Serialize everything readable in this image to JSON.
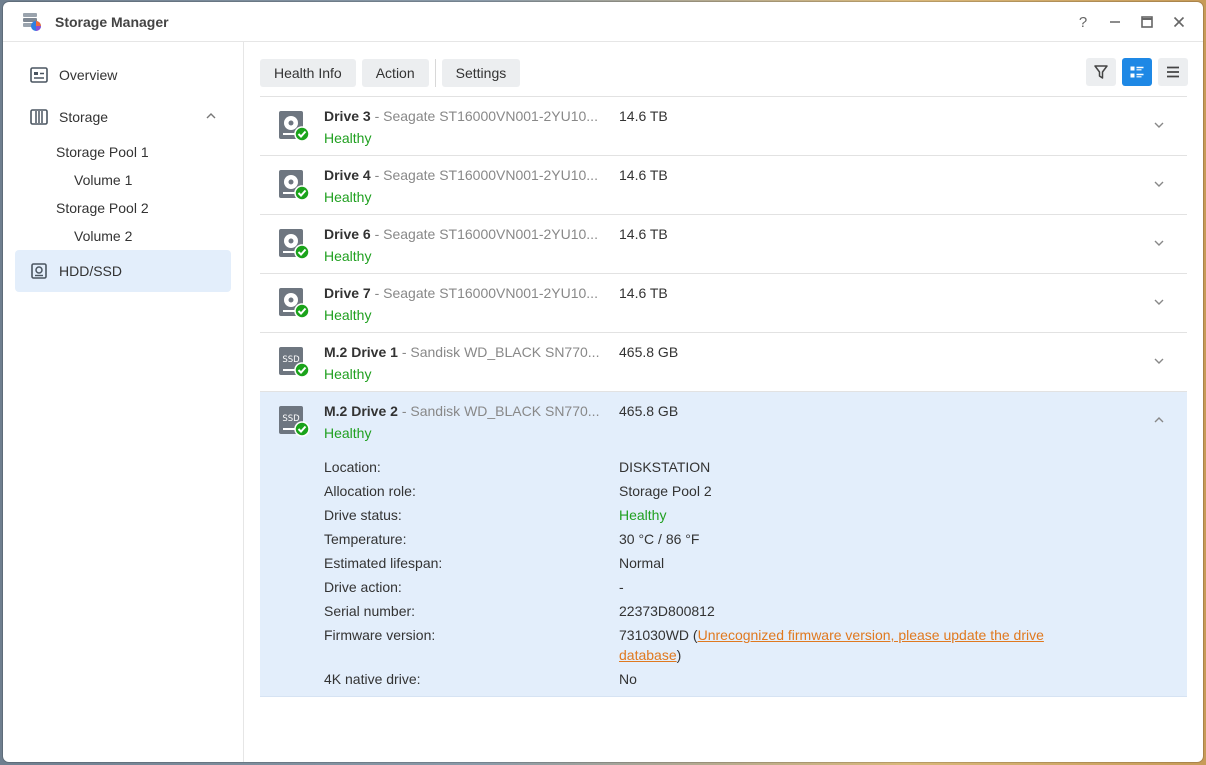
{
  "window": {
    "title": "Storage Manager",
    "controls": [
      "?",
      "–",
      "□",
      "×"
    ]
  },
  "sidebar": {
    "items": [
      {
        "label": "Overview",
        "icon": "overview-icon"
      },
      {
        "label": "Storage",
        "icon": "storage-icon",
        "expanded": true
      },
      {
        "label": "HDD/SSD",
        "icon": "hdd-icon",
        "active": true
      }
    ],
    "storage_children": [
      {
        "label": "Storage Pool 1",
        "level": 1
      },
      {
        "label": "Volume 1",
        "level": 2
      },
      {
        "label": "Storage Pool 2",
        "level": 1
      },
      {
        "label": "Volume 2",
        "level": 2
      }
    ]
  },
  "toolbar": {
    "health_info": "Health Info",
    "action": "Action",
    "settings": "Settings"
  },
  "drives": [
    {
      "name": "Drive 3",
      "model": " - Seagate ST16000VN001-2YU10...",
      "size": "14.6 TB",
      "status": "Healthy",
      "type": "hdd"
    },
    {
      "name": "Drive 4",
      "model": " - Seagate ST16000VN001-2YU10...",
      "size": "14.6 TB",
      "status": "Healthy",
      "type": "hdd"
    },
    {
      "name": "Drive 6",
      "model": " - Seagate ST16000VN001-2YU10...",
      "size": "14.6 TB",
      "status": "Healthy",
      "type": "hdd"
    },
    {
      "name": "Drive 7",
      "model": " - Seagate ST16000VN001-2YU10...",
      "size": "14.6 TB",
      "status": "Healthy",
      "type": "hdd"
    },
    {
      "name": "M.2 Drive 1",
      "model": " - Sandisk WD_BLACK SN770...",
      "size": "465.8 GB",
      "status": "Healthy",
      "type": "ssd"
    },
    {
      "name": "M.2 Drive 2",
      "model": " - Sandisk WD_BLACK SN770...",
      "size": "465.8 GB",
      "status": "Healthy",
      "type": "ssd",
      "expanded": true
    }
  ],
  "ssd_label": "SSD",
  "details": {
    "location": {
      "label": "Location:",
      "value": "DISKSTATION"
    },
    "allocation": {
      "label": "Allocation role:",
      "value": "Storage Pool 2"
    },
    "status": {
      "label": "Drive status:",
      "value": "Healthy"
    },
    "temperature": {
      "label": "Temperature:",
      "value": "30 °C / 86 °F"
    },
    "lifespan": {
      "label": "Estimated lifespan:",
      "value": "Normal"
    },
    "action": {
      "label": "Drive action:",
      "value": "-"
    },
    "serial": {
      "label": "Serial number:",
      "value": "22373D800812"
    },
    "firmware": {
      "label": "Firmware version:",
      "value": "731030WD (",
      "link": "Unrecognized firmware version, please update the drive database",
      "suffix": ")"
    },
    "native4k": {
      "label": "4K native drive:",
      "value": "No"
    }
  },
  "colors": {
    "accent": "#1e88e5",
    "healthy": "#20a020",
    "warning_link": "#e0791f",
    "selected_bg": "#e3eefb"
  }
}
